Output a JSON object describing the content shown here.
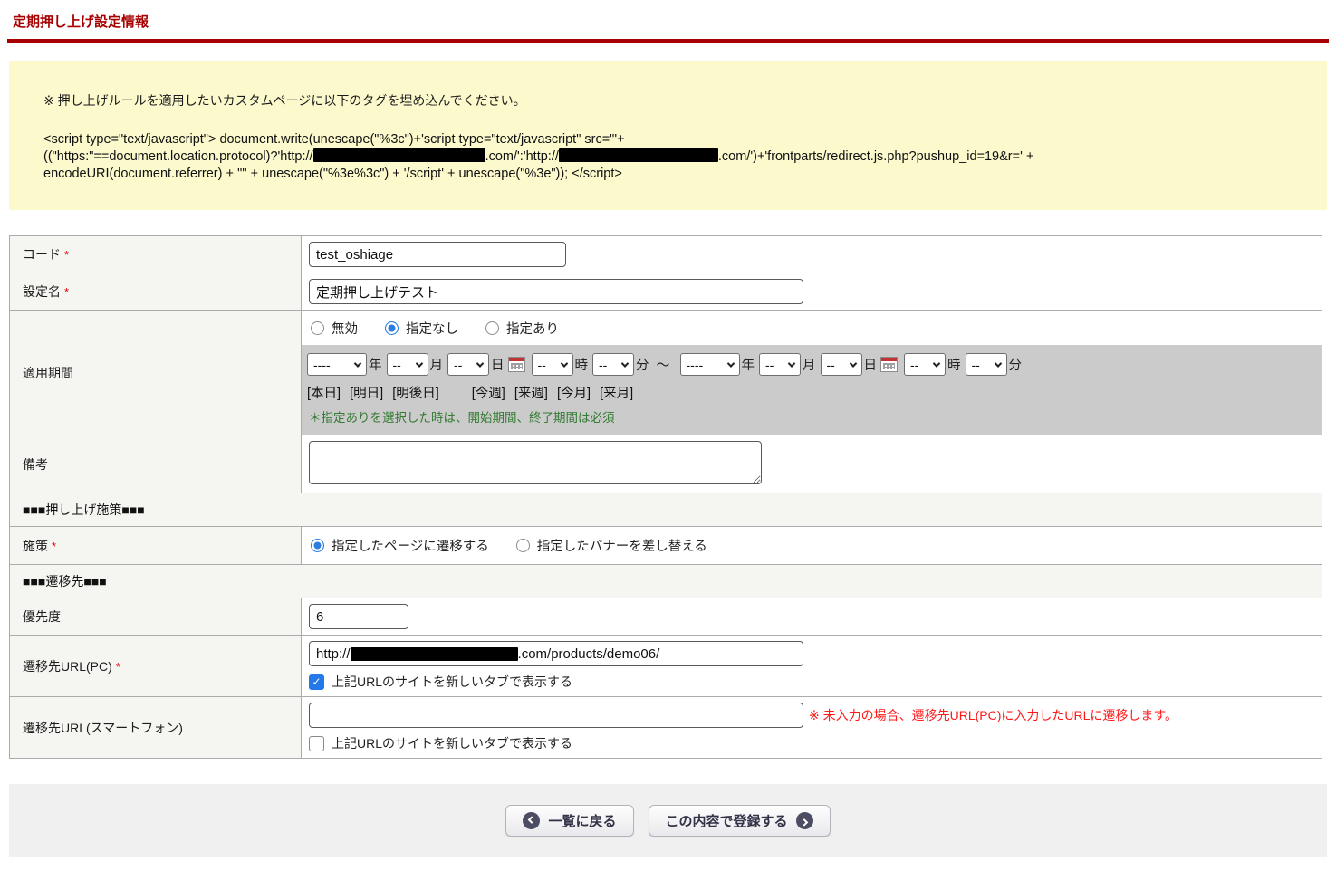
{
  "page": {
    "title": "定期押し上げ設定情報"
  },
  "notice": {
    "instruction": "※ 押し上げルールを適用したいカスタムページに以下のタグを埋め込んでください。",
    "script_line1": "<script type=\"text/javascript\"> document.write(unescape(\"%3c\")+'script type=\"text/javascript\" src=\"'+",
    "script_line2_a": "((\"https:\"==document.location.protocol)?'http://",
    "script_line2_b": ".com/':'http://",
    "script_line2_c": ".com/')+'frontparts/redirect.js.php?pushup_id=19&r=' +",
    "script_line3": "encodeURI(document.referrer) + '\"' + unescape(\"%3e%3c\") + '/script' + unescape(\"%3e\")); </script>"
  },
  "form": {
    "code": {
      "label": "コード",
      "required": "*",
      "value": "test_oshiage"
    },
    "name": {
      "label": "設定名",
      "required": "*",
      "value": "定期押し上げテスト"
    },
    "period": {
      "label": "適用期間",
      "options": {
        "disabled": "無効",
        "none": "指定なし",
        "specified": "指定あり"
      },
      "selected": "指定なし",
      "ph_year": "----",
      "ph_blank": "--",
      "unit_year": "年",
      "unit_month": "月",
      "unit_day": "日",
      "unit_hour": "時",
      "unit_minute": "分",
      "range_tilde": "～",
      "shortcuts": [
        "[本日]",
        "[明日]",
        "[明後日]",
        "[今週]",
        "[来週]",
        "[今月]",
        "[来月]"
      ],
      "note": "＊指定ありを選択した時は、開始期間、終了期間は必須"
    },
    "remarks": {
      "label": "備考",
      "value": ""
    },
    "section_measure": "■■■押し上げ施策■■■",
    "measure": {
      "label": "施策",
      "required": "*",
      "options": {
        "redirect": "指定したページに遷移する",
        "banner": "指定したバナーを差し替える"
      },
      "selected": "指定したページに遷移する"
    },
    "section_destination": "■■■遷移先■■■",
    "priority": {
      "label": "優先度",
      "value": "6"
    },
    "url_pc": {
      "label": "遷移先URL(PC)",
      "required": "*",
      "value_prefix": "http://",
      "value_suffix": ".com/products/demo06/",
      "newtab_label": "上記URLのサイトを新しいタブで表示する",
      "newtab_checked": true
    },
    "url_sp": {
      "label": "遷移先URL(スマートフォン)",
      "value": "",
      "newtab_label": "上記URLのサイトを新しいタブで表示する",
      "newtab_checked": false,
      "note": "※ 未入力の場合、遷移先URL(PC)に入力したURLに遷移します。"
    }
  },
  "buttons": {
    "back": "一覧に戻る",
    "submit": "この内容で登録する"
  },
  "colors": {
    "title_red": "#a70000",
    "notice_bg": "#fcf9cd",
    "label_bg": "#f5f5f2",
    "period_panel_gray": "#cbcbcb",
    "accent_blue": "#2478e8",
    "note_green": "#337a33",
    "note_red": "#ff1a1a"
  }
}
